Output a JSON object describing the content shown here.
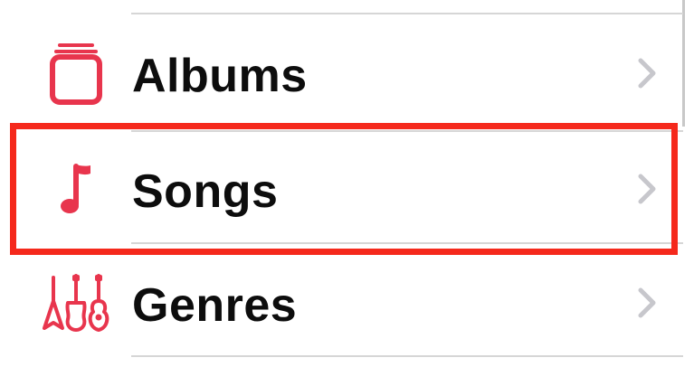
{
  "menu": {
    "items": [
      {
        "label": "Albums",
        "icon": "albums-icon"
      },
      {
        "label": "Songs",
        "icon": "music-note-icon"
      },
      {
        "label": "Genres",
        "icon": "guitars-icon"
      }
    ]
  },
  "highlight": {
    "target": "Songs",
    "color": "#f5291c"
  },
  "colors": {
    "accent": "#e8354d",
    "chevron": "#c7c7cc",
    "separator": "#d6d6d6"
  }
}
